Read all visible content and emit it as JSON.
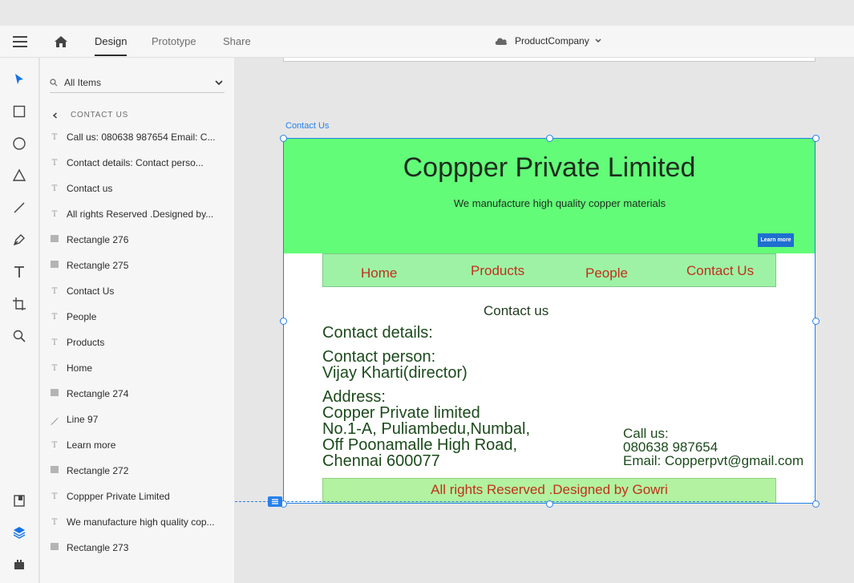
{
  "topbar": {
    "tabs": [
      {
        "label": "Design",
        "active": true
      },
      {
        "label": "Prototype",
        "active": false
      },
      {
        "label": "Share",
        "active": false
      }
    ],
    "document_name": "ProductCompany"
  },
  "layers_panel": {
    "search_value": "All Items",
    "back_label": "CONTACT US",
    "items": [
      {
        "type": "text",
        "label": "Call us:  080638 987654  Email: C..."
      },
      {
        "type": "text",
        "label": "Contact details:       Contact perso..."
      },
      {
        "type": "text",
        "label": "Contact us"
      },
      {
        "type": "text",
        "label": "All rights Reserved .Designed by..."
      },
      {
        "type": "rect",
        "label": "Rectangle 276"
      },
      {
        "type": "rect",
        "label": "Rectangle 275"
      },
      {
        "type": "text",
        "label": "Contact Us"
      },
      {
        "type": "text",
        "label": "People"
      },
      {
        "type": "text",
        "label": "Products"
      },
      {
        "type": "text",
        "label": "Home"
      },
      {
        "type": "rect",
        "label": "Rectangle 274"
      },
      {
        "type": "line",
        "label": "Line 97"
      },
      {
        "type": "text",
        "label": "Learn more"
      },
      {
        "type": "rect",
        "label": "Rectangle 272"
      },
      {
        "type": "text",
        "label": "Coppper Private Limited"
      },
      {
        "type": "text",
        "label": "We manufacture high quality cop..."
      },
      {
        "type": "rect",
        "label": "Rectangle 273"
      }
    ]
  },
  "artboard": {
    "name": "Contact Us",
    "title": "Coppper Private Limited",
    "subtitle": "We manufacture high quality copper materials",
    "learn_more": "Learn more",
    "nav": [
      "Home",
      "Products",
      "People",
      "Contact Us"
    ],
    "contact_heading": "Contact us",
    "contact_details": "Contact details:",
    "contact_person_label": "Contact person:",
    "contact_person": "Vijay Kharti(director)",
    "address_label": "Address:",
    "address_lines": [
      "Copper Private limited",
      "No.1-A, Puliambedu,Numbal,",
      "Off Poonamalle High Road,",
      "Chennai 600077"
    ],
    "call_label": "Call us:",
    "phone": "080638 987654",
    "email": "Email: Copperpvt@gmail.com",
    "footer": "All rights Reserved .Designed by Gowri"
  },
  "colors": {
    "header_green": "#62fc78",
    "nav_green": "#9ef2a6",
    "footer_green": "#b2f2a0",
    "nav_text_red": "#c2301c",
    "selection_blue": "#2680eb"
  }
}
